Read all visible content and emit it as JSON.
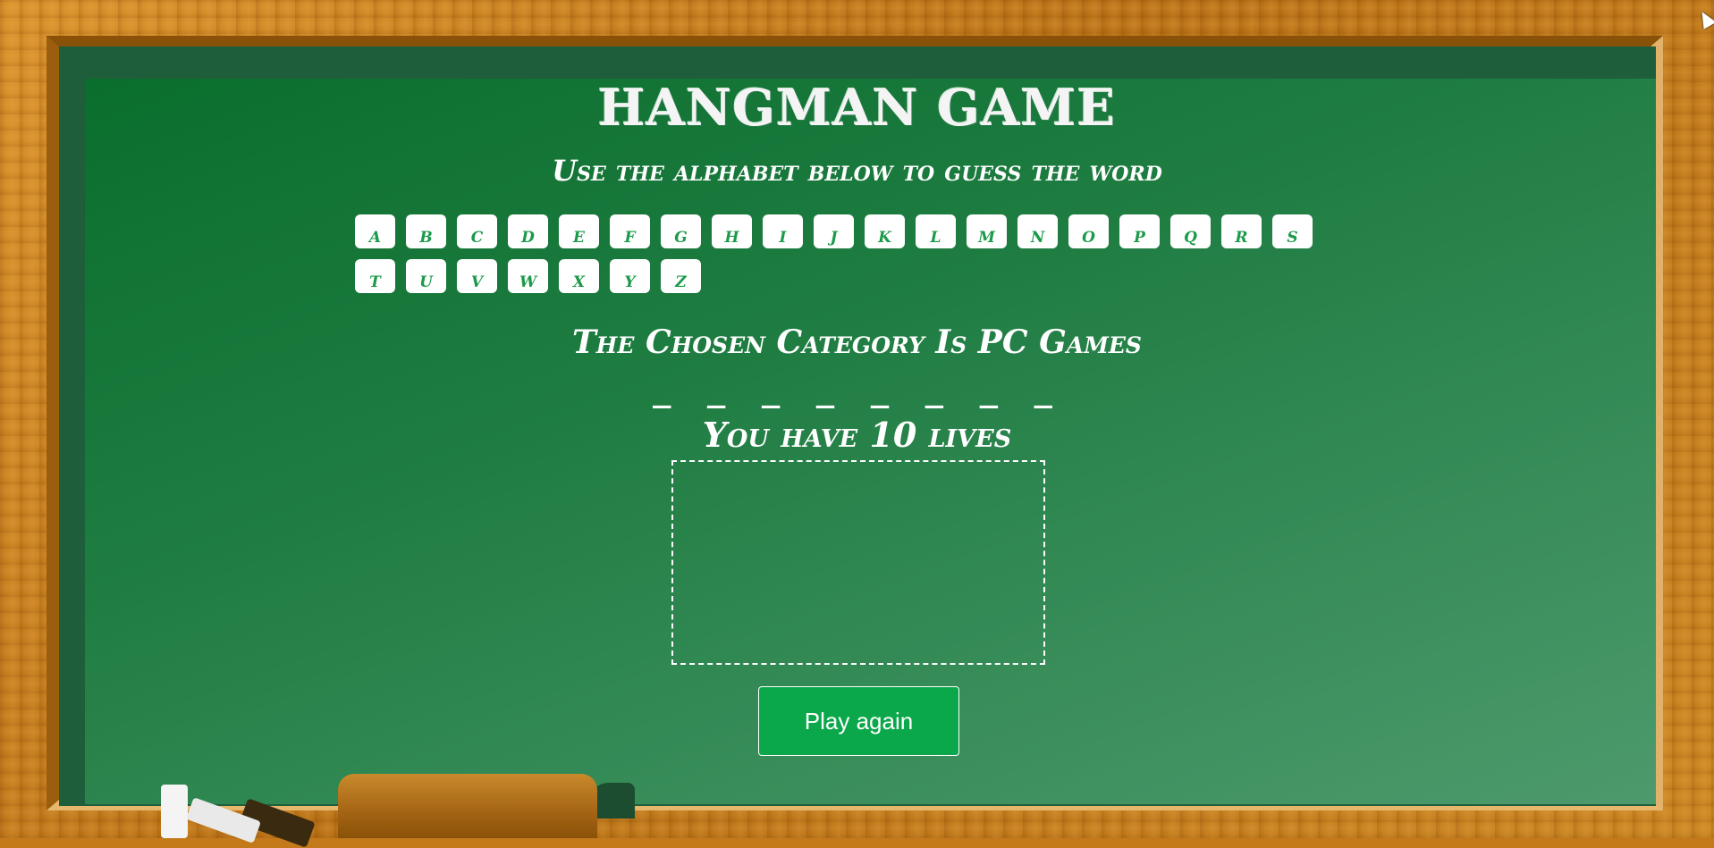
{
  "game": {
    "title": "HANGMAN GAME",
    "subtitle": "Use the alphabet below to guess the word",
    "alphabet": [
      "A",
      "B",
      "C",
      "D",
      "E",
      "F",
      "G",
      "H",
      "I",
      "J",
      "K",
      "L",
      "M",
      "N",
      "O",
      "P",
      "Q",
      "R",
      "S",
      "T",
      "U",
      "V",
      "W",
      "X",
      "Y",
      "Z"
    ],
    "category_text": "The Chosen Category Is PC Games",
    "word_display": "_ _ _ _ _ _ _ _",
    "lives_text": "You have 10 lives",
    "play_again_label": "Play again"
  },
  "colors": {
    "board_green": "#1f7d42",
    "letter_text": "#1b9a4a",
    "button_green": "#0aa84a",
    "frame_wood": "#c47a1b"
  },
  "icons": {
    "cursor": "mouse-pointer-icon",
    "eraser": "chalkboard-eraser-icon",
    "chalk": "chalk-icon"
  }
}
